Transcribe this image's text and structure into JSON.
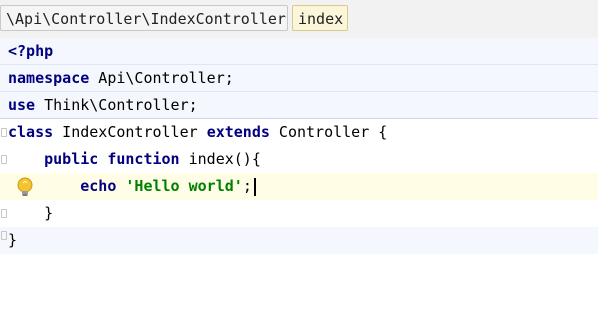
{
  "breadcrumb": {
    "items": [
      {
        "label": "\\Api\\Controller\\IndexController"
      },
      {
        "label": "index"
      }
    ]
  },
  "code": {
    "line1": {
      "tag": "<?php"
    },
    "line2": {
      "keyword": "namespace",
      "rest": " Api\\Controller;"
    },
    "line3": {
      "keyword": "use",
      "rest": " Think\\Controller;"
    },
    "line4": {
      "kw_class": "class",
      "name": " IndexController ",
      "kw_extends": "extends",
      "rest": " Controller {"
    },
    "line5": {
      "indent": "    ",
      "kw_public": "public",
      "sp": " ",
      "kw_function": "function",
      "rest": " index(){"
    },
    "line6": {
      "indent": "        ",
      "kw_echo": "echo",
      "sp": " ",
      "string": "'Hello world'",
      "semicolon": ";"
    },
    "line7": {
      "brace": "    }"
    },
    "line8": {
      "brace": "}"
    }
  },
  "icons": {
    "intention": "lightbulb-icon",
    "fold": "fold-marker-icon"
  },
  "colors": {
    "keyword": "#000080",
    "string": "#008000",
    "current_line": "#fffde6",
    "breadcrumb_active": "#fbf6d9"
  }
}
